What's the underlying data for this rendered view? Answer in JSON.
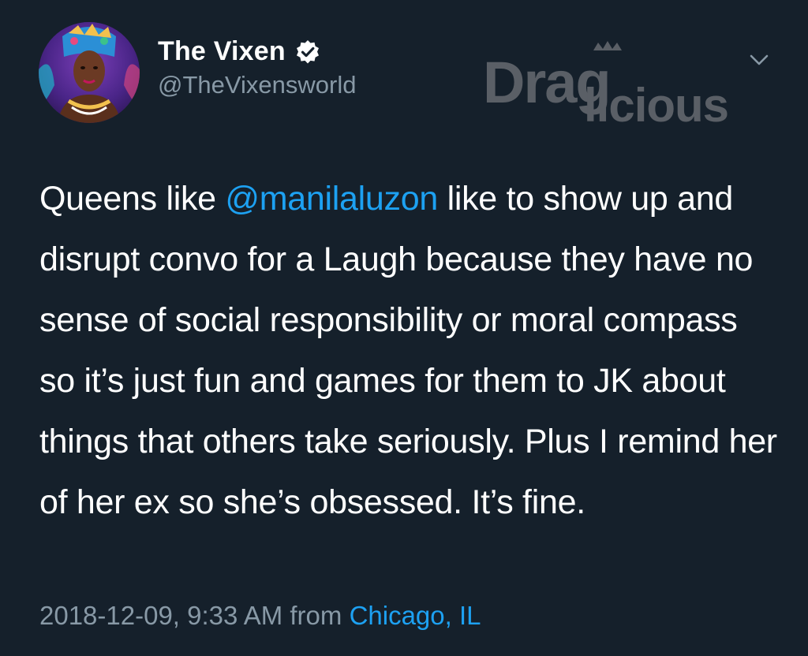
{
  "author": {
    "display_name": "The Vixen",
    "handle": "@TheVixensworld",
    "verified": true,
    "avatar_icon": "profile-photo"
  },
  "watermark": {
    "text": "Draglicious",
    "color": "#5a5f66"
  },
  "menu_icon": "chevron-down-icon",
  "tweet": {
    "text_before": "Queens like ",
    "mention": "@manilaluzon",
    "text_after": " like to show up and disrupt convo for a Laugh because they have no sense of social responsibility or moral compass so it’s just fun and games for them to JK about things that others take seriously. Plus I remind her of her ex so she’s obsessed. It’s fine."
  },
  "meta": {
    "timestamp": "2018-12-09, 9:33 AM",
    "from_label": " from ",
    "location": "Chicago, IL"
  },
  "colors": {
    "background": "#15202b",
    "text": "#ffffff",
    "secondary": "#8899a6",
    "link": "#1da1f2"
  }
}
